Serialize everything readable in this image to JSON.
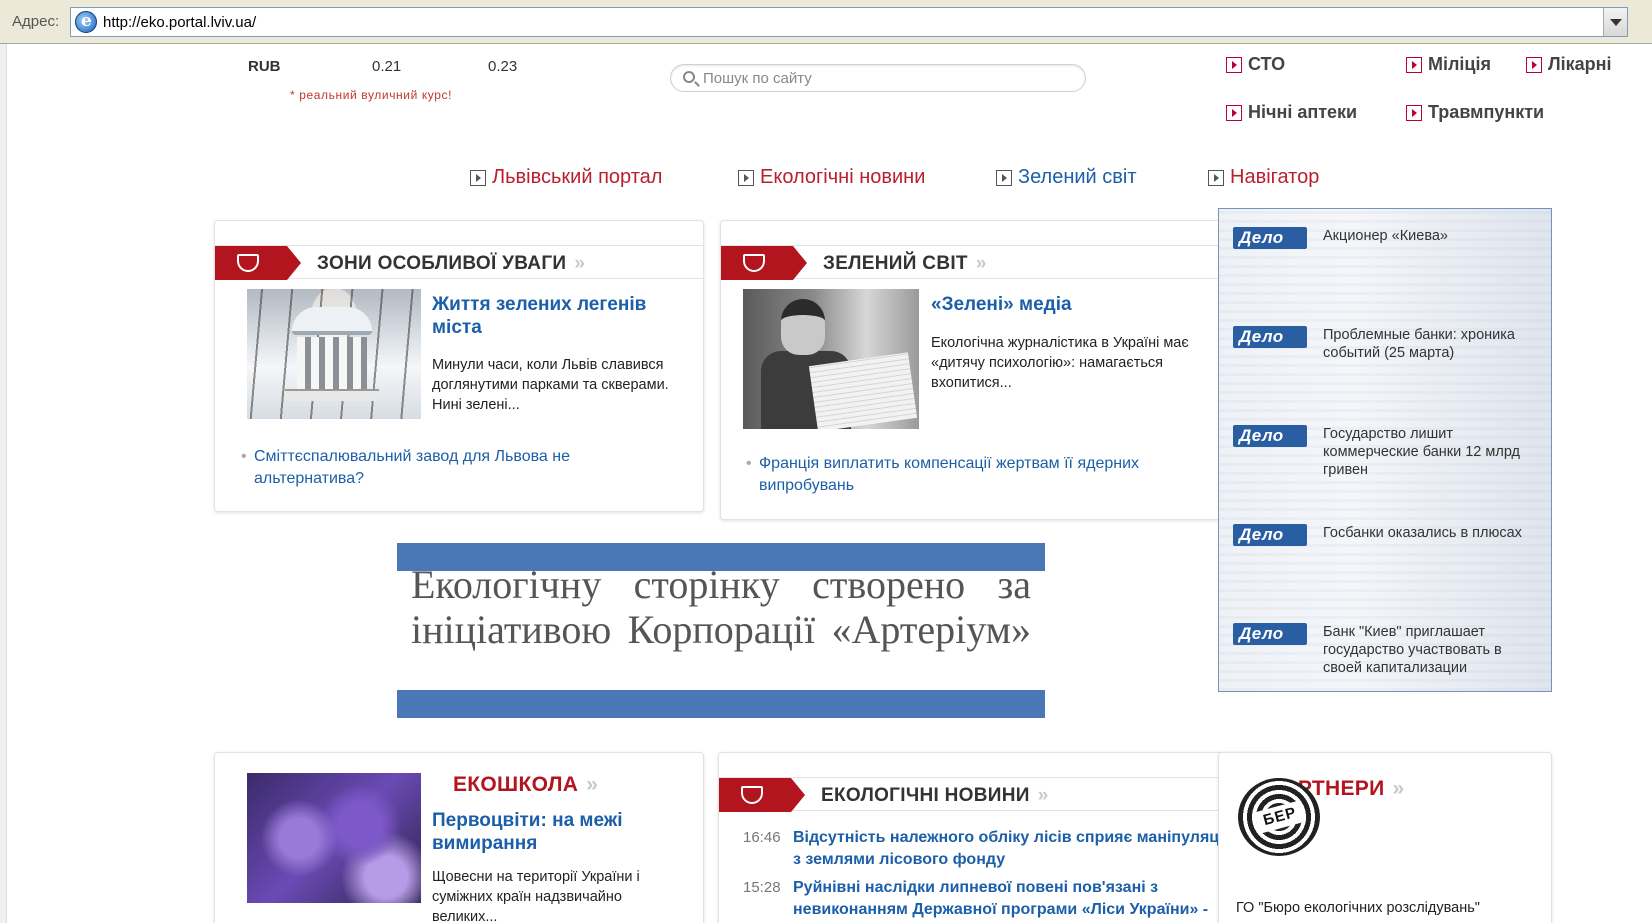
{
  "browser": {
    "address_label": "Адрес:",
    "url": "http://eko.portal.lviv.ua/"
  },
  "currency": {
    "rows": [
      {
        "code": "RUB",
        "buy": "0.21",
        "sell": "0.23"
      }
    ],
    "note": "* реальний вуличний курс!"
  },
  "search": {
    "placeholder": "Пошук по сайту"
  },
  "quick_links": {
    "sto": "СТО",
    "militsiia": "Міліція",
    "likarni": "Лікарні",
    "nichni_apteky": "Нічні аптеки",
    "travmpunkty": "Травмпункти"
  },
  "nav": {
    "lviv_portal": "Львівський портал",
    "eco_news": "Екологічні новини",
    "green_world": "Зелений світ",
    "navigator": "Навігатор"
  },
  "zones_card": {
    "title": "ЗОНИ ОСОБЛИВОЇ УВАГИ",
    "headline": "Життя зелених легенів міста",
    "text": "Минули часи, коли Львів славився доглянутими парками та скверами. Нині зелені...",
    "bullet": "Сміттєспалювальний завод для Львова не альтернатива?"
  },
  "green_card": {
    "title": "ЗЕЛЕНИЙ СВІТ",
    "headline": "«Зелені» медіа",
    "text": "Екологічна журналістика в Україні має «дитячу психологію»: намагається вхопитися...",
    "bullet": "Франція виплатить компенсації жертвам її ядерних випробувань"
  },
  "banner": {
    "text": "Екологічну сторінку створено за ініціативою Корпорації «Артеріум»",
    "color": "#4a77b5"
  },
  "delo": {
    "logo": "Дело",
    "items": [
      "Акционер «Киева»",
      "Проблемные банки: хроника событий (25 марта)",
      "Государство лишит коммерческие банки 12 млрд гривен",
      "Госбанки оказались в плюсах",
      "Банк \"Киев\" приглашает государство участвовать в своей капитализации"
    ]
  },
  "eco_school": {
    "title": "ЕКОШКОЛА",
    "headline": "Первоцвіти: на межі вимирання",
    "text": "Щовесни на території України і суміжних країн надзвичайно великих..."
  },
  "eco_news_card": {
    "title": "ЕКОЛОГІЧНІ НОВИНИ",
    "items": [
      {
        "time": "16:46",
        "title": "Відсутність належного обліку лісів сприяє маніпуляціям з землями лісового фонду"
      },
      {
        "time": "15:28",
        "title": "Руйнівні наслідки липневої повені пов'язані з невиконанням Державної програми «Ліси України» -"
      }
    ]
  },
  "partners": {
    "title": "ПАРТНЕРИ",
    "logo_text": "БЕР",
    "caption": "ГО \"Бюро екологічних розслідувань\""
  },
  "colors": {
    "accent_red": "#b3151f",
    "link_blue": "#1c5fa8"
  }
}
